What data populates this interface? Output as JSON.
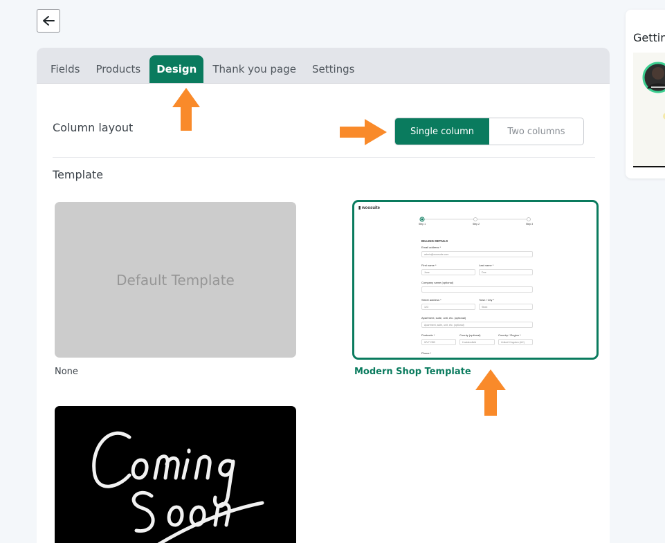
{
  "tabs": [
    {
      "label": "Fields",
      "active": false
    },
    {
      "label": "Products",
      "active": false
    },
    {
      "label": "Design",
      "active": true
    },
    {
      "label": "Thank you page",
      "active": false
    },
    {
      "label": "Settings",
      "active": false
    }
  ],
  "column_layout": {
    "title": "Column layout",
    "options": [
      "Single column",
      "Two columns"
    ],
    "selected": "Single column"
  },
  "template": {
    "title": "Template",
    "items": [
      {
        "thumb_text": "Default Template",
        "caption": "None",
        "selected": false
      },
      {
        "caption": "Modern Shop Template",
        "selected": true
      },
      {
        "thumb_text": "Coming Soon",
        "caption": "",
        "selected": false
      }
    ]
  },
  "preview": {
    "logo": "woosuite",
    "steps": [
      "Step 1",
      "Step 2",
      "Step 3"
    ],
    "heading": "BILLING DETAILS",
    "email_label": "Email address *",
    "email_value": "admin@woosuite.com",
    "first_name_label": "First name *",
    "first_name_value": "Jane",
    "last_name_label": "Last name *",
    "last_name_value": "Doe",
    "company_label": "Company name (optional)",
    "street_label": "Street address *",
    "street_value": "123",
    "town_label": "Town / City *",
    "town_value": "Stout",
    "apartment_label": "Apartment, suite, unit, etc. (optional)",
    "apartment_placeholder": "Apartment, suite, unit, etc. (optional)",
    "postcode_label": "Postcode *",
    "postcode_value": "WV7 2DB",
    "county_label": "County (optional)",
    "county_value": "Huddersfield",
    "country_label": "Country / Region *",
    "country_value": "United Kingdom (UK)",
    "phone_label": "Phone *"
  },
  "sidebar": {
    "title": "Getting"
  },
  "colors": {
    "accent": "#0a7b5e",
    "annotation_arrow": "#f98a2a",
    "tabbar_bg": "#e3e5ea"
  },
  "icons": [
    "back-arrow-icon",
    "woosuite-logo-icon",
    "annotation-arrow-icon"
  ]
}
